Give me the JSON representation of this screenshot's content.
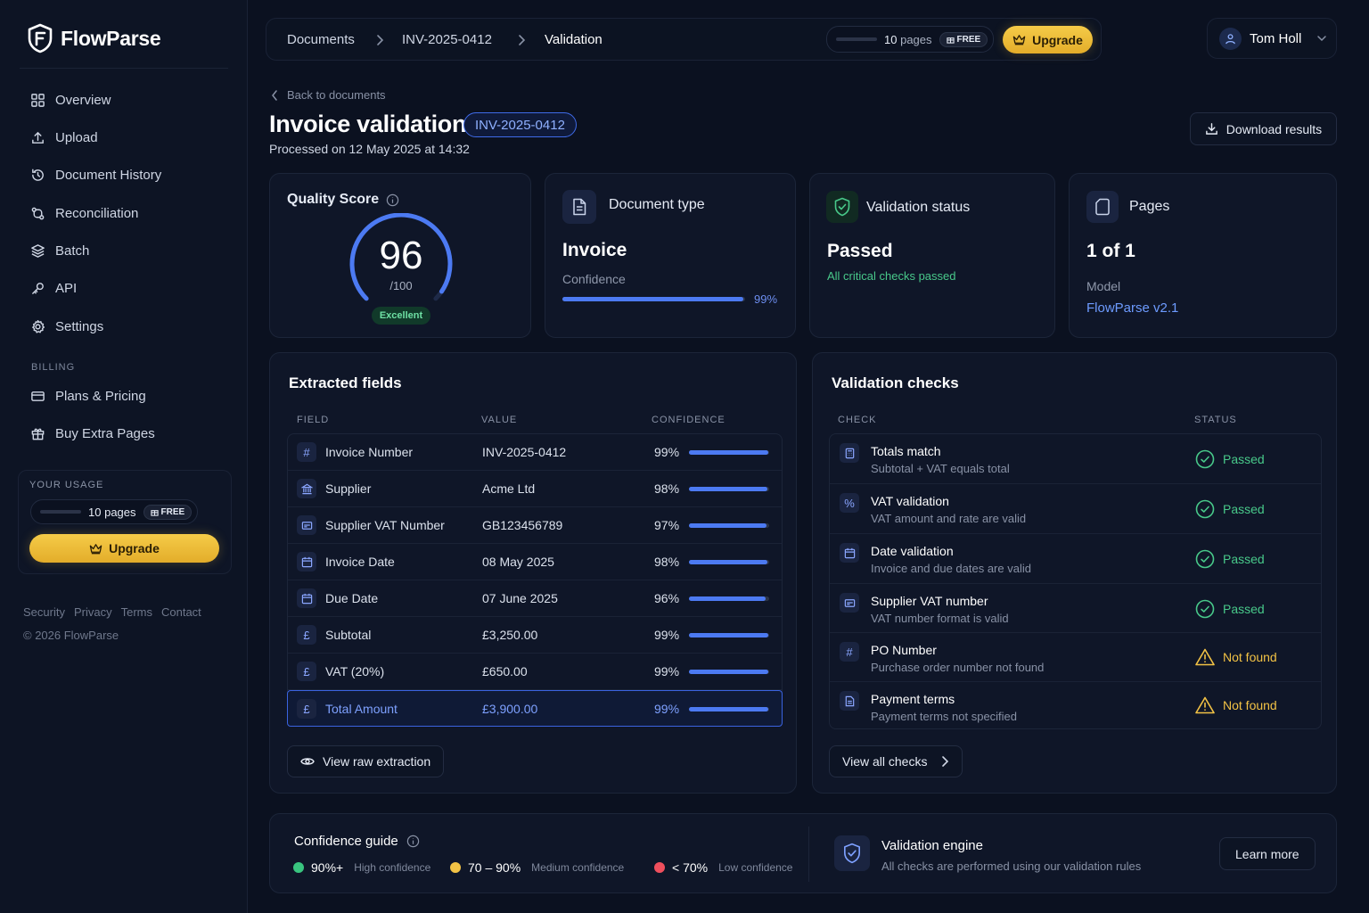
{
  "app": {
    "name": "FlowParse"
  },
  "sidebar": {
    "items": [
      {
        "label": "Overview",
        "icon": "grid-icon"
      },
      {
        "label": "Upload",
        "icon": "upload-icon"
      },
      {
        "label": "Document History",
        "icon": "history-icon"
      },
      {
        "label": "Reconciliation",
        "icon": "reconcile-icon"
      },
      {
        "label": "Batch",
        "icon": "layers-icon"
      },
      {
        "label": "API",
        "icon": "key-icon"
      },
      {
        "label": "Settings",
        "icon": "gear-icon"
      }
    ],
    "billing_label": "BILLING",
    "billing_items": [
      {
        "label": "Plans & Pricing",
        "icon": "card-icon"
      },
      {
        "label": "Buy Extra Pages",
        "icon": "gift-icon"
      }
    ],
    "usage": {
      "title": "YOUR USAGE",
      "pages": "10",
      "unit": "pages",
      "plan": "FREE",
      "upgrade": "Upgrade"
    },
    "footer_links": [
      "Security",
      "Privacy",
      "Terms",
      "Contact"
    ],
    "copyright": "© 2026 FlowParse"
  },
  "topbar": {
    "breadcrumbs": [
      "Documents",
      "INV-2025-0412",
      "Validation"
    ],
    "pages": "10",
    "unit": "pages",
    "plan": "FREE",
    "upgrade": "Upgrade",
    "user": "Tom Holl"
  },
  "header": {
    "back": "Back to documents",
    "title": "Invoice validation",
    "doc_id": "INV-2025-0412",
    "processed": "Processed on 12 May 2025 at 14:32",
    "download": "Download results"
  },
  "stats": {
    "quality": {
      "title": "Quality Score",
      "score": "96",
      "max": "/100",
      "score_value": 96,
      "rating": "Excellent"
    },
    "doc_type": {
      "title": "Document type",
      "value": "Invoice",
      "confidence_label": "Confidence",
      "confidence": "99%",
      "confidence_value": 0.99
    },
    "validation": {
      "title": "Validation status",
      "value": "Passed",
      "note": "All critical checks passed"
    },
    "pages": {
      "title": "Pages",
      "value": "1 of 1",
      "model_label": "Model",
      "model": "FlowParse v2.1"
    }
  },
  "fields": {
    "title": "Extracted fields",
    "columns": [
      "FIELD",
      "VALUE",
      "CONFIDENCE"
    ],
    "rows": [
      {
        "icon": "#",
        "field": "Invoice Number",
        "value": "INV-2025-0412",
        "confidence": "99%",
        "level": 0.99
      },
      {
        "icon": "bank",
        "field": "Supplier",
        "value": "Acme Ltd",
        "confidence": "98%",
        "level": 0.98
      },
      {
        "icon": "id",
        "field": "Supplier VAT Number",
        "value": "GB123456789",
        "confidence": "97%",
        "level": 0.97
      },
      {
        "icon": "cal",
        "field": "Invoice Date",
        "value": "08 May 2025",
        "confidence": "98%",
        "level": 0.98
      },
      {
        "icon": "cal",
        "field": "Due Date",
        "value": "07 June 2025",
        "confidence": "96%",
        "level": 0.96
      },
      {
        "icon": "£",
        "field": "Subtotal",
        "value": "£3,250.00",
        "confidence": "99%",
        "level": 0.99
      },
      {
        "icon": "£",
        "field": "VAT (20%)",
        "value": "£650.00",
        "confidence": "99%",
        "level": 0.99
      },
      {
        "icon": "£",
        "field": "Total Amount",
        "value": "£3,900.00",
        "confidence": "99%",
        "level": 0.99
      }
    ],
    "view_raw": "View raw extraction"
  },
  "checks": {
    "title": "Validation checks",
    "columns": [
      "CHECK",
      "STATUS"
    ],
    "rows": [
      {
        "icon": "calc",
        "name": "Totals match",
        "desc": "Subtotal + VAT equals total",
        "status": "Passed",
        "state": "ok"
      },
      {
        "icon": "%",
        "name": "VAT validation",
        "desc": "VAT amount and rate are valid",
        "status": "Passed",
        "state": "ok"
      },
      {
        "icon": "cal",
        "name": "Date validation",
        "desc": "Invoice and due dates are valid",
        "status": "Passed",
        "state": "ok"
      },
      {
        "icon": "id",
        "name": "Supplier VAT number",
        "desc": "VAT number format is valid",
        "status": "Passed",
        "state": "ok"
      },
      {
        "icon": "#",
        "name": "PO Number",
        "desc": "Purchase order number not found",
        "status": "Not found",
        "state": "warn"
      },
      {
        "icon": "doc",
        "name": "Payment terms",
        "desc": "Payment terms not specified",
        "status": "Not found",
        "state": "warn"
      }
    ],
    "view_all": "View all checks"
  },
  "guide": {
    "title": "Confidence guide",
    "items": [
      {
        "label": "90%+",
        "sub": "High confidence",
        "color": "#39c47f"
      },
      {
        "label": "70 – 90%",
        "sub": "Medium confidence",
        "color": "#f2c245"
      },
      {
        "label": "< 70%",
        "sub": "Low confidence",
        "color": "#ef4f5d"
      }
    ],
    "engine_title": "Validation engine",
    "engine_desc": "All checks are performed using our validation rules",
    "learn_more": "Learn more"
  },
  "colors": {
    "accent": "#4c7af2",
    "success": "#48c98a",
    "warning": "#f2c245",
    "gold": "#f0bf3c"
  }
}
